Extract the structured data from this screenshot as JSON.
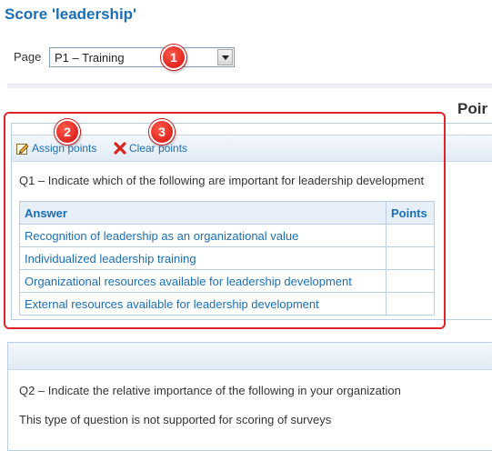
{
  "title": "Score 'leadership'",
  "page_selector": {
    "label": "Page",
    "selected": "P1 – Training"
  },
  "heading_right": "Poir",
  "callouts": [
    "1",
    "2",
    "3"
  ],
  "question1": {
    "toolbar": {
      "assign_label": "Assign points",
      "clear_label": "Clear points"
    },
    "text": "Q1 – Indicate which of the following are important for leadership development",
    "table": {
      "headers": [
        "Answer",
        "Points"
      ],
      "rows": [
        {
          "answer": "Recognition of leadership as an organizational value",
          "points": ""
        },
        {
          "answer": "Individualized leadership training",
          "points": ""
        },
        {
          "answer": "Organizational resources available for leadership development",
          "points": ""
        },
        {
          "answer": "External resources available for leadership development",
          "points": ""
        }
      ]
    }
  },
  "question2": {
    "text": "Q2 – Indicate the relative importance of the following in your organization",
    "note": "This type of question is not supported for scoring of surveys"
  },
  "colors": {
    "accent": "#1a6eb5",
    "callout": "#e0232a",
    "panel_border": "#b9cde3"
  },
  "icons": {
    "assign": "pencil-icon",
    "clear": "red-x-icon",
    "select": "chevron-down-icon"
  }
}
